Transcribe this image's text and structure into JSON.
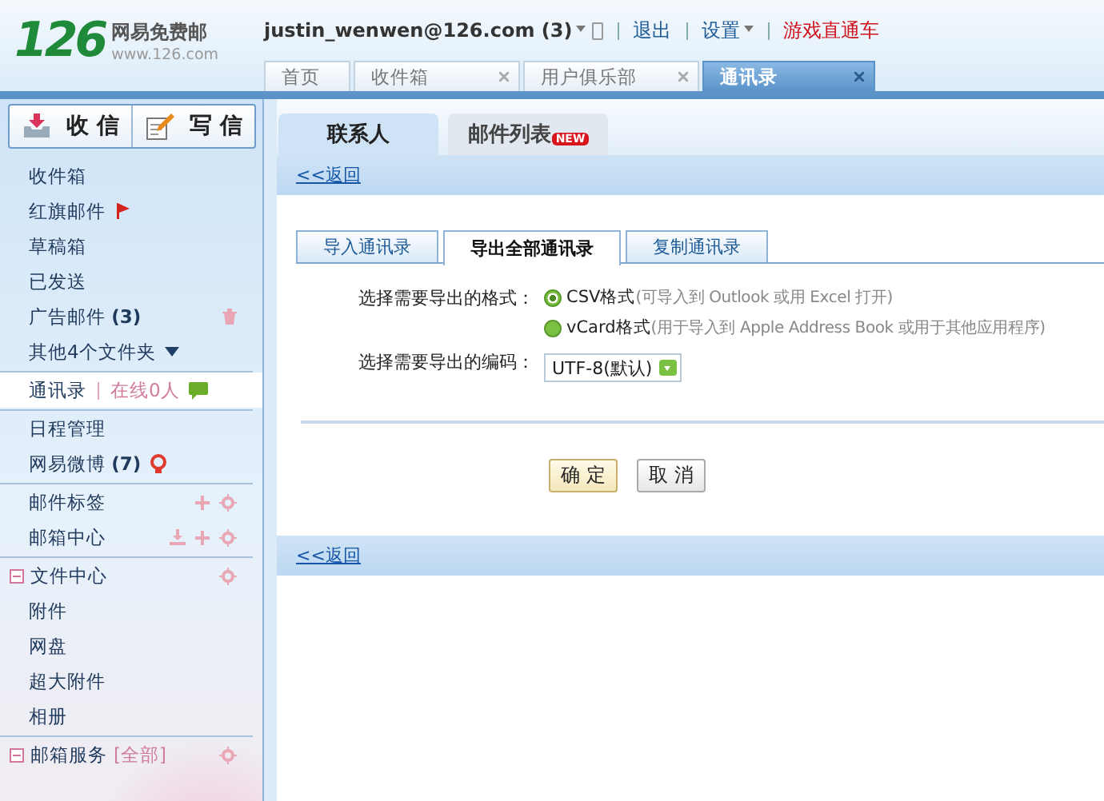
{
  "logo": {
    "mark": "126",
    "title": "网易免费邮",
    "url": "www.126.com"
  },
  "account": {
    "email": "justin_wenwen@126.com (3)"
  },
  "top_links": [
    {
      "label": "退出",
      "kind": "link"
    },
    {
      "label": "设置",
      "kind": "menu"
    },
    {
      "label": "游戏直通车",
      "kind": "promo"
    }
  ],
  "tabs": [
    {
      "label": "首页",
      "selected": false,
      "closable": false
    },
    {
      "label": "收件箱",
      "selected": false,
      "closable": true
    },
    {
      "label": "用户俱乐部",
      "selected": false,
      "closable": true
    },
    {
      "label": "通讯录",
      "selected": true,
      "closable": true
    }
  ],
  "sidebar": {
    "actions": [
      {
        "label": "收 信",
        "kind": "receive"
      },
      {
        "label": "写 信",
        "kind": "compose"
      }
    ],
    "groups": [
      [
        {
          "label": "收件箱",
          "selected": false
        },
        {
          "label": "红旗邮件",
          "kind": "flagged",
          "selected": false
        },
        {
          "label": "草稿箱",
          "selected": false
        },
        {
          "label": "已发送",
          "selected": false
        },
        {
          "label": "广告邮件 **(3)**",
          "kind": "ads",
          "selected": false
        },
        {
          "label": "其他4个文件夹",
          "kind": "more",
          "selected": false
        }
      ],
      [
        {
          "label": "通讯录",
          "kind": "contacts",
          "selected": true,
          "extra": "在线0人"
        }
      ],
      [
        {
          "label": "日程管理",
          "selected": false
        },
        {
          "label": "网易微博 **(7)**",
          "kind": "weibo",
          "selected": false
        }
      ],
      [
        {
          "label": "邮件标签",
          "kind": "tags",
          "selected": false
        },
        {
          "label": "邮箱中心",
          "kind": "mailcenter",
          "selected": false
        }
      ],
      [
        {
          "label": "文件中心",
          "kind": "filecenter",
          "selected": false,
          "expanded": true,
          "children": [
            {
              "label": "附件",
              "selected": false
            },
            {
              "label": "网盘",
              "selected": false
            },
            {
              "label": "超大附件",
              "selected": false
            },
            {
              "label": "相册",
              "selected": false
            }
          ]
        }
      ],
      [
        {
          "label": "邮箱服务",
          "kind": "services",
          "selected": false,
          "expanded": true,
          "extra": "[全部]"
        }
      ]
    ]
  },
  "view_tabs": [
    {
      "label": "联系人",
      "selected": true
    },
    {
      "label": "邮件列表",
      "selected": false,
      "badge": "NEW"
    }
  ],
  "back_link_top": "<<返回",
  "sub_tabs": [
    {
      "label": "导入通讯录",
      "selected": false
    },
    {
      "label": "导出全部通讯录",
      "selected": true
    },
    {
      "label": "复制通讯录",
      "selected": false
    }
  ],
  "form": {
    "format_label": "选择需要导出的格式：",
    "formats": [
      {
        "label": "CSV格式",
        "hint": "(可导入到 Outlook 或用 Excel 打开)",
        "selected": true
      },
      {
        "label": "vCard格式",
        "hint": "(用于导入到 Apple Address Book 或用于其他应用程序)",
        "selected": false
      }
    ],
    "encoding_label": "选择需要导出的编码：",
    "encoding": {
      "value": "UTF-8(默认)"
    }
  },
  "buttons": [
    {
      "label": "确 定",
      "kind": "primary"
    },
    {
      "label": "取 消",
      "kind": "secondary"
    }
  ],
  "back_link_bottom": "<<返回"
}
